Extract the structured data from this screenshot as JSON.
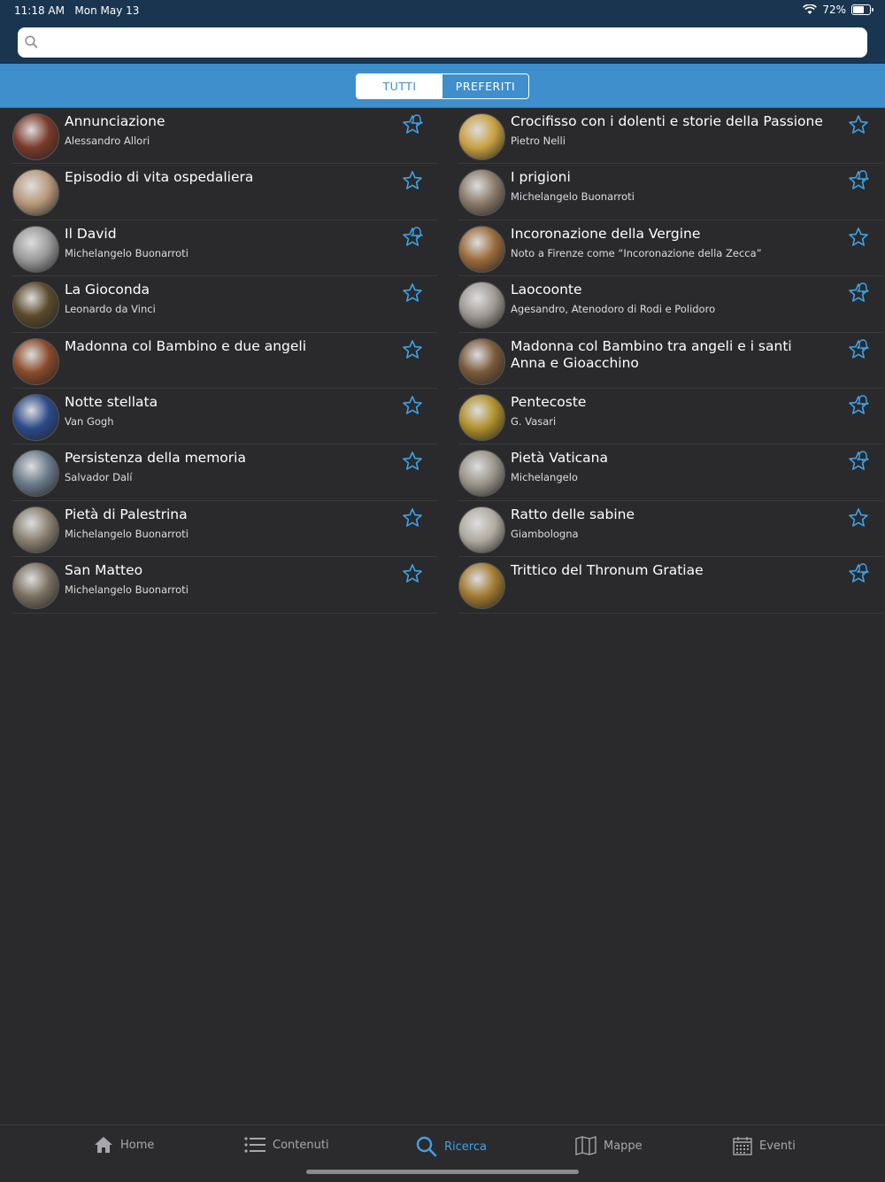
{
  "status": {
    "time": "11:18 AM",
    "date": "Mon May 13",
    "battery": "72%",
    "battery_level": 0.72
  },
  "search": {
    "placeholder": "",
    "value": ""
  },
  "segments": {
    "all": "TUTTI",
    "favorites": "PREFERITI",
    "selected": "favorites"
  },
  "items_left": [
    {
      "title": "Annunciazione",
      "subtitle": "Alessandro Allori",
      "color": "#7a3a2a",
      "favorite": true
    },
    {
      "title": "Episodio di vita ospedaliera",
      "subtitle": "",
      "color": "#b89a7a",
      "favorite": false
    },
    {
      "title": "Il David",
      "subtitle": "Michelangelo Buonarroti",
      "color": "#9a9a9a",
      "favorite": true
    },
    {
      "title": "La Gioconda",
      "subtitle": "Leonardo da Vinci",
      "color": "#5a4a2a",
      "favorite": false
    },
    {
      "title": "Madonna col Bambino e due angeli",
      "subtitle": "",
      "color": "#8a4a2a",
      "favorite": false
    },
    {
      "title": "Notte stellata",
      "subtitle": "Van Gogh",
      "color": "#2a4a8a",
      "favorite": false
    },
    {
      "title": "Persistenza della memoria",
      "subtitle": "Salvador Dalí",
      "color": "#6a7a8a",
      "favorite": false
    },
    {
      "title": "Pietà di Palestrina",
      "subtitle": "Michelangelo Buonarroti",
      "color": "#8a8070",
      "favorite": false
    },
    {
      "title": "San Matteo",
      "subtitle": "Michelangelo Buonarroti",
      "color": "#7a7060",
      "favorite": false
    }
  ],
  "items_right": [
    {
      "title": "Crocifisso con i dolenti e storie della Passione",
      "subtitle": "Pietro Nelli",
      "color": "#c8a040",
      "favorite": false
    },
    {
      "title": "I prigioni",
      "subtitle": "Michelangelo Buonarroti",
      "color": "#8a7a6a",
      "favorite": true
    },
    {
      "title": "Incoronazione della Vergine",
      "subtitle": "Noto a Firenze come “Incoronazione della Zecca”",
      "color": "#9a6a3a",
      "favorite": false
    },
    {
      "title": "Laocoonte",
      "subtitle": "Agesandro, Atenodoro di Rodi e Polidoro",
      "color": "#a09a94",
      "favorite": true
    },
    {
      "title": "Madonna col Bambino tra angeli e i santi Anna e Gioacchino",
      "subtitle": "",
      "color": "#7a5a3a",
      "favorite": true
    },
    {
      "title": "Pentecoste",
      "subtitle": "G. Vasari",
      "color": "#b0902a",
      "favorite": true
    },
    {
      "title": "Pietà Vaticana",
      "subtitle": "Michelangelo",
      "color": "#9a948a",
      "favorite": true
    },
    {
      "title": "Ratto delle sabine",
      "subtitle": "Giambologna",
      "color": "#b0aaa0",
      "favorite": false
    },
    {
      "title": "Trittico del Thronum Gratiae",
      "subtitle": "",
      "color": "#a07a30",
      "favorite": true
    }
  ],
  "tabs": [
    {
      "label": "Home",
      "icon": "home-icon",
      "active": false
    },
    {
      "label": "Contenuti",
      "icon": "list-icon",
      "active": false
    },
    {
      "label": "Ricerca",
      "icon": "search-icon",
      "active": true
    },
    {
      "label": "Mappe",
      "icon": "map-icon",
      "active": false
    },
    {
      "label": "Eventi",
      "icon": "calendar-icon",
      "active": false
    }
  ],
  "colors": {
    "accent": "#3ea3e8",
    "header": "#1a3550",
    "segment_bar": "#3e8fcb",
    "background": "#2a2a2c"
  }
}
